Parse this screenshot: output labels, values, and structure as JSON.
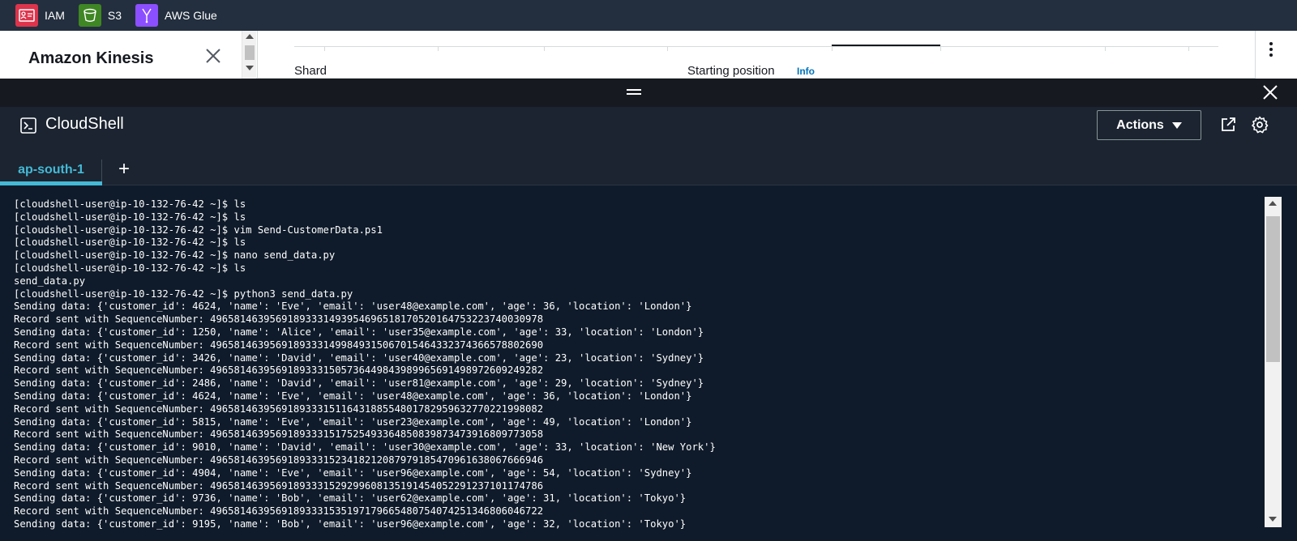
{
  "favorites": [
    {
      "label": "IAM",
      "color": "#dd344c"
    },
    {
      "label": "S3",
      "color": "#3f8624"
    },
    {
      "label": "AWS Glue",
      "color": "#8c4fff"
    }
  ],
  "console": {
    "service_title": "Amazon Kinesis",
    "shard_label": "Shard",
    "starting_position_label": "Starting position",
    "info_link": "Info"
  },
  "cloudshell": {
    "title": "CloudShell",
    "actions_label": "Actions",
    "tabs": [
      {
        "label": "ap-south-1",
        "active": true
      }
    ],
    "add_tab": "+",
    "accent_color": "#44b9d6",
    "terminal_lines": [
      "[cloudshell-user@ip-10-132-76-42 ~]$ ls",
      "[cloudshell-user@ip-10-132-76-42 ~]$ ls",
      "[cloudshell-user@ip-10-132-76-42 ~]$ vim Send-CustomerData.ps1",
      "[cloudshell-user@ip-10-132-76-42 ~]$ ls",
      "[cloudshell-user@ip-10-132-76-42 ~]$ nano send_data.py",
      "[cloudshell-user@ip-10-132-76-42 ~]$ ls",
      "send_data.py",
      "[cloudshell-user@ip-10-132-76-42 ~]$ python3 send_data.py",
      "Sending data: {'customer_id': 4624, 'name': 'Eve', 'email': 'user48@example.com', 'age': 36, 'location': 'London'}",
      "Record sent with SequenceNumber: 49658146395691893331493954696518170520164753223740030978",
      "Sending data: {'customer_id': 1250, 'name': 'Alice', 'email': 'user35@example.com', 'age': 33, 'location': 'London'}",
      "Record sent with SequenceNumber: 49658146395691893331499849315067015464332374366578802690",
      "Sending data: {'customer_id': 3426, 'name': 'David', 'email': 'user40@example.com', 'age': 23, 'location': 'Sydney'}",
      "Record sent with SequenceNumber: 49658146395691893331505736449843989965691498972609249282",
      "Sending data: {'customer_id': 2486, 'name': 'David', 'email': 'user81@example.com', 'age': 29, 'location': 'Sydney'}",
      "Sending data: {'customer_id': 4624, 'name': 'Eve', 'email': 'user48@example.com', 'age': 36, 'location': 'London'}",
      "Record sent with SequenceNumber: 49658146395691893331511643188554801782959632770221998082",
      "Sending data: {'customer_id': 5815, 'name': 'Eve', 'email': 'user23@example.com', 'age': 49, 'location': 'London'}",
      "Record sent with SequenceNumber: 49658146395691893331517525493364850839873473916809773058",
      "Sending data: {'customer_id': 9010, 'name': 'David', 'email': 'user30@example.com', 'age': 33, 'location': 'New York'}",
      "Record sent with SequenceNumber: 49658146395691893331523418212087979185470961638067666946",
      "Sending data: {'customer_id': 4904, 'name': 'Eve', 'email': 'user96@example.com', 'age': 54, 'location': 'Sydney'}",
      "Record sent with SequenceNumber: 49658146395691893331529299608135191454052291237101174786",
      "Sending data: {'customer_id': 9736, 'name': 'Bob', 'email': 'user62@example.com', 'age': 31, 'location': 'Tokyo'}",
      "Record sent with SequenceNumber: 49658146395691893331535197179665480754074251346806046722",
      "Sending data: {'customer_id': 9195, 'name': 'Bob', 'email': 'user96@example.com', 'age': 32, 'location': 'Tokyo'}"
    ]
  }
}
